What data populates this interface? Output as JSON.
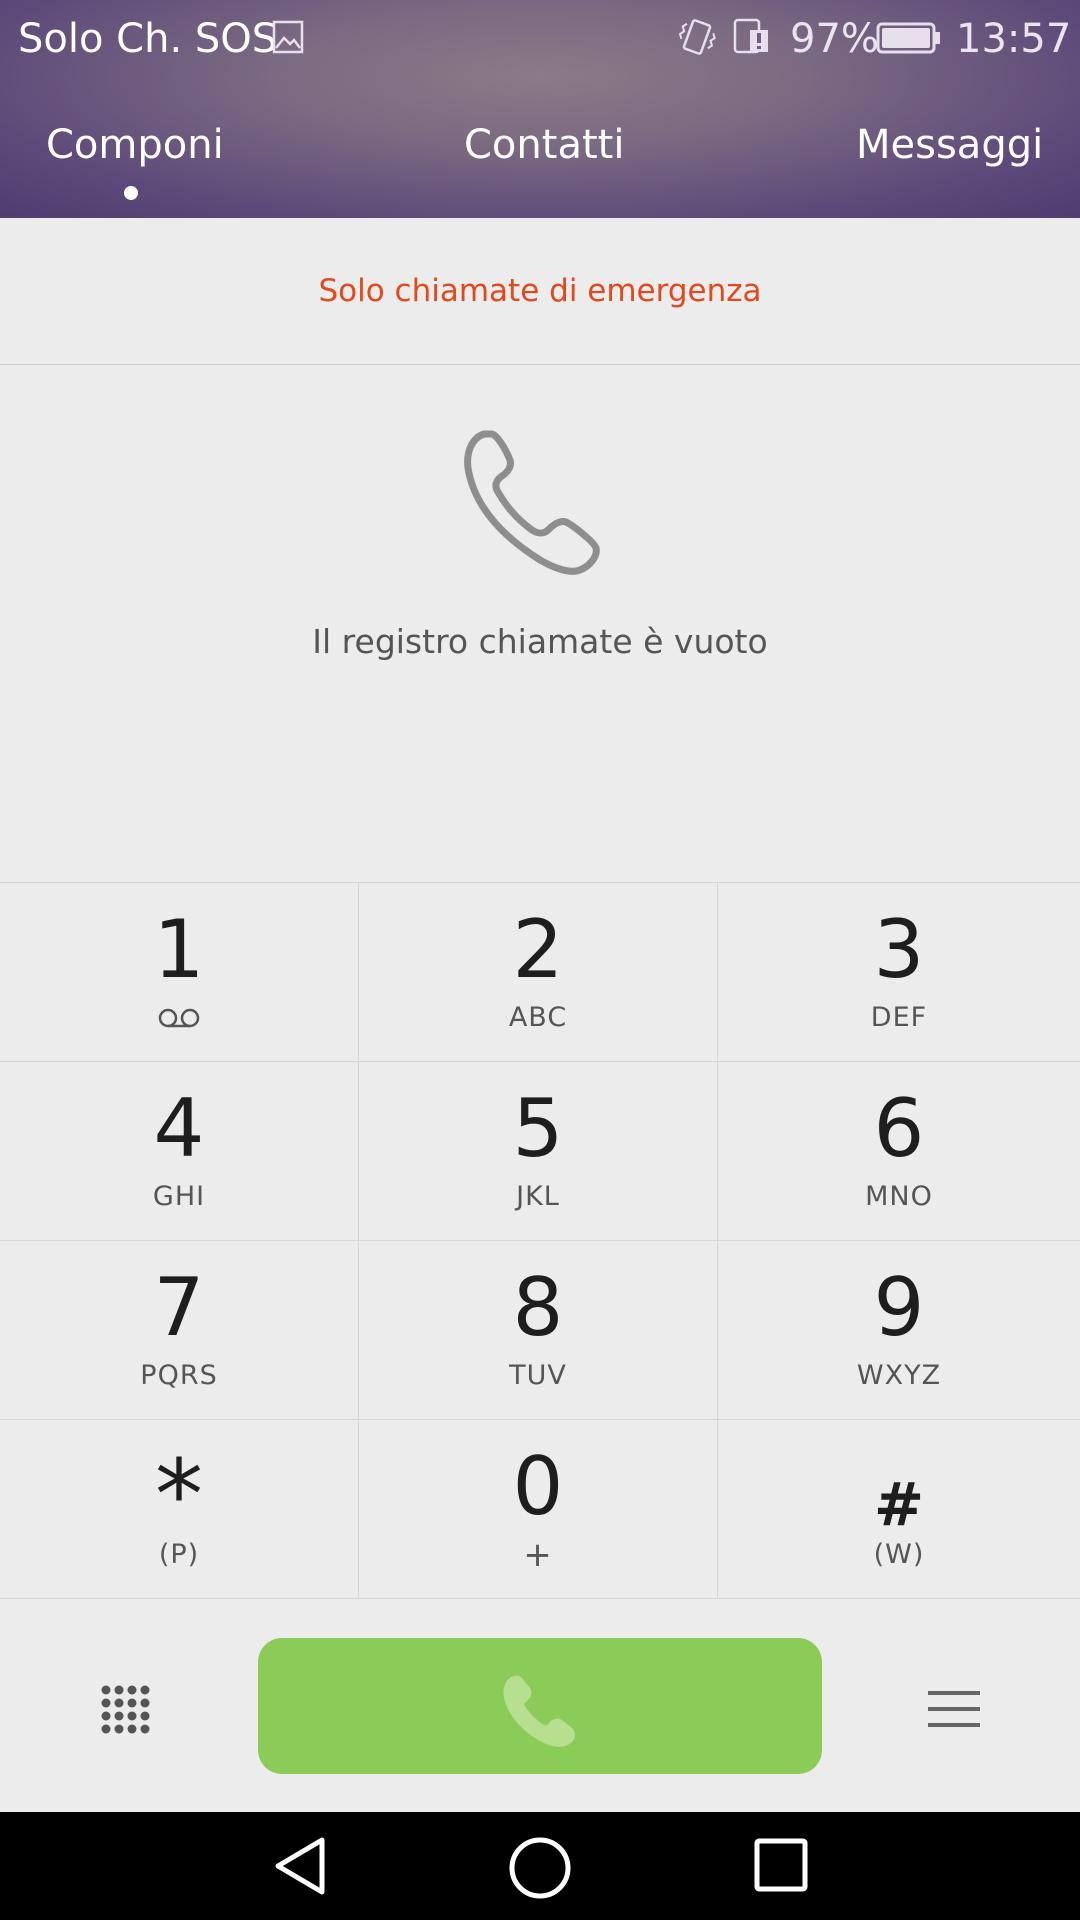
{
  "status_bar": {
    "carrier": "Solo Ch. SOS",
    "battery": "97%",
    "time": "13:57",
    "icons": [
      "image-icon",
      "vibrate-icon",
      "sim-alert-icon",
      "battery-icon"
    ]
  },
  "tabs": [
    {
      "label": "Componi",
      "active": true
    },
    {
      "label": "Contatti",
      "active": false
    },
    {
      "label": "Messaggi",
      "active": false
    }
  ],
  "notice": "Solo chiamate di emergenza",
  "call_log": {
    "icon": "phone-icon",
    "empty_message": "Il registro chiamate è vuoto"
  },
  "keypad": [
    {
      "digit": "1",
      "letters": "voicemail"
    },
    {
      "digit": "2",
      "letters": "ABC"
    },
    {
      "digit": "3",
      "letters": "DEF"
    },
    {
      "digit": "4",
      "letters": "GHI"
    },
    {
      "digit": "5",
      "letters": "JKL"
    },
    {
      "digit": "6",
      "letters": "MNO"
    },
    {
      "digit": "7",
      "letters": "PQRS"
    },
    {
      "digit": "8",
      "letters": "TUV"
    },
    {
      "digit": "9",
      "letters": "WXYZ"
    },
    {
      "digit": "*",
      "letters": "(P)"
    },
    {
      "digit": "0",
      "letters": "+"
    },
    {
      "digit": "#",
      "letters": "(W)"
    }
  ],
  "bottom_bar": {
    "left_icon": "dialpad-icon",
    "call_icon": "phone-icon",
    "right_icon": "menu-icon"
  },
  "colors": {
    "header_purple": "#6b5a80",
    "notice_orange": "#e04a1e",
    "call_green": "#8bcb57",
    "background": "#ececec"
  }
}
